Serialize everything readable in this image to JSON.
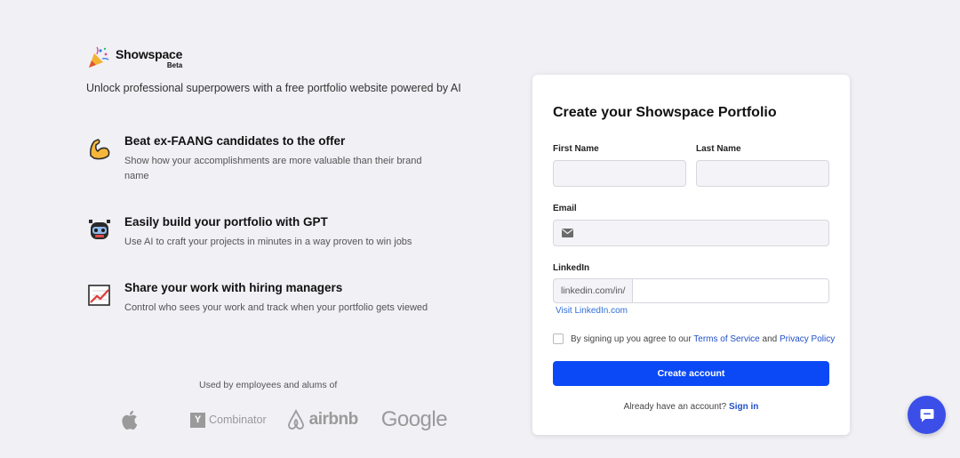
{
  "brand": {
    "name": "Showspace",
    "badge": "Beta"
  },
  "tagline": "Unlock professional superpowers with a free portfolio website powered by AI",
  "features": [
    {
      "icon": "flexed-biceps-icon",
      "title": "Beat ex-FAANG candidates to the offer",
      "description": "Show how your accomplishments are more valuable than their brand name"
    },
    {
      "icon": "robot-icon",
      "title": "Easily build your portfolio with GPT",
      "description": "Use AI to craft your projects in minutes in a way proven to win jobs"
    },
    {
      "icon": "chart-increasing-icon",
      "title": "Share your work with hiring managers",
      "description": "Control who sees your work and track when your portfolio gets viewed"
    }
  ],
  "used_by": {
    "label": "Used by employees and alums of",
    "logos": [
      {
        "name": "apple-logo",
        "text": ""
      },
      {
        "name": "y-combinator-logo",
        "badge": "Y",
        "text": "Combinator"
      },
      {
        "name": "airbnb-logo",
        "text": "airbnb"
      },
      {
        "name": "google-logo",
        "text": "Google"
      }
    ]
  },
  "form": {
    "title": "Create your Showspace Portfolio",
    "first_name": {
      "label": "First Name",
      "value": "",
      "placeholder": ""
    },
    "last_name": {
      "label": "Last Name",
      "value": "",
      "placeholder": ""
    },
    "email": {
      "label": "Email",
      "value": "",
      "placeholder": "",
      "icon": "envelope-icon"
    },
    "linkedin": {
      "label": "LinkedIn",
      "prefix": "linkedin.com/in/",
      "value": "",
      "placeholder": "",
      "visit_link": "Visit LinkedIn.com"
    },
    "agree": {
      "checked": false,
      "prefix": "By signing up you agree to our",
      "terms": "Terms of Service",
      "and": "and",
      "privacy": "Privacy Policy"
    },
    "submit_label": "Create account",
    "signin": {
      "prompt": "Already have an account?",
      "link": "Sign in"
    }
  },
  "chat": {
    "icon": "chat-bubble-icon"
  },
  "colors": {
    "background": "#f0f0f5",
    "primary": "#0a49f5",
    "link": "#1f4fc9",
    "chat": "#3b4ee8"
  }
}
